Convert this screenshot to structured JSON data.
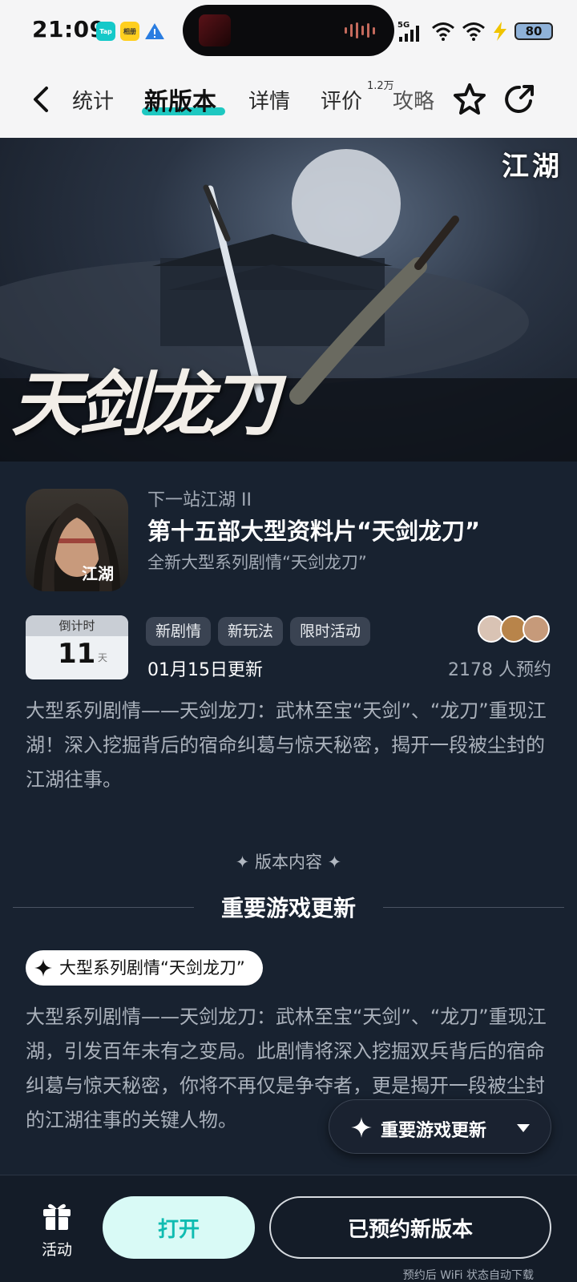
{
  "status_bar": {
    "time": "21:09",
    "apps": [
      "Tap",
      "相册"
    ],
    "network": "5G",
    "battery": "80"
  },
  "nav": {
    "tabs": [
      {
        "label": "统计"
      },
      {
        "label": "新版本"
      },
      {
        "label": "详情"
      },
      {
        "label": "评价"
      },
      {
        "label": "攻略"
      }
    ],
    "review_badge": "1.2万",
    "icons": [
      "back-icon",
      "star-outline-icon",
      "share-icon"
    ]
  },
  "banner": {
    "logo": "江湖",
    "title": "天剑龙刀"
  },
  "info": {
    "app_name": "下一站江湖 II",
    "version_title": "第十五部大型资料片“天剑龙刀”",
    "version_subtitle": "全新大型系列剧情“天剑龙刀”",
    "icon_text": "江湖",
    "countdown": {
      "label": "倒计时",
      "value": "11",
      "unit": "天"
    },
    "tags": [
      "新剧情",
      "新玩法",
      "限时活动"
    ],
    "update_date": "01月15日更新",
    "reserve_count": "2178 人预约",
    "description": "大型系列剧情——天剑龙刀：武林至宝“天剑”、“龙刀”重现江湖！深入挖掘背后的宿命纠葛与惊天秘密，揭开一段被尘封的江湖往事。"
  },
  "content": {
    "section_label": "✦ 版本内容 ✦",
    "section_heading": "重要游戏更新",
    "pill": "大型系列剧情“天剑龙刀”",
    "body": "大型系列剧情——天剑龙刀：武林至宝“天剑”、“龙刀”重现江湖，引发百年未有之变局。此剧情将深入挖掘双兵背后的宿命纠葛与惊天秘密，你将不再仅是争夺者，更是揭开一段被尘封的江湖往事的关键人物。"
  },
  "float_nav": {
    "label": "重要游戏更新"
  },
  "bottom": {
    "activity_label": "活动",
    "open_label": "打开",
    "reserved_label": "已预约新版本",
    "note": "预约后 WiFi 状态自动下载"
  },
  "colors": {
    "accent": "#1ec8c1",
    "open_bg": "#d9faf6",
    "dark_bg": "#182230"
  }
}
